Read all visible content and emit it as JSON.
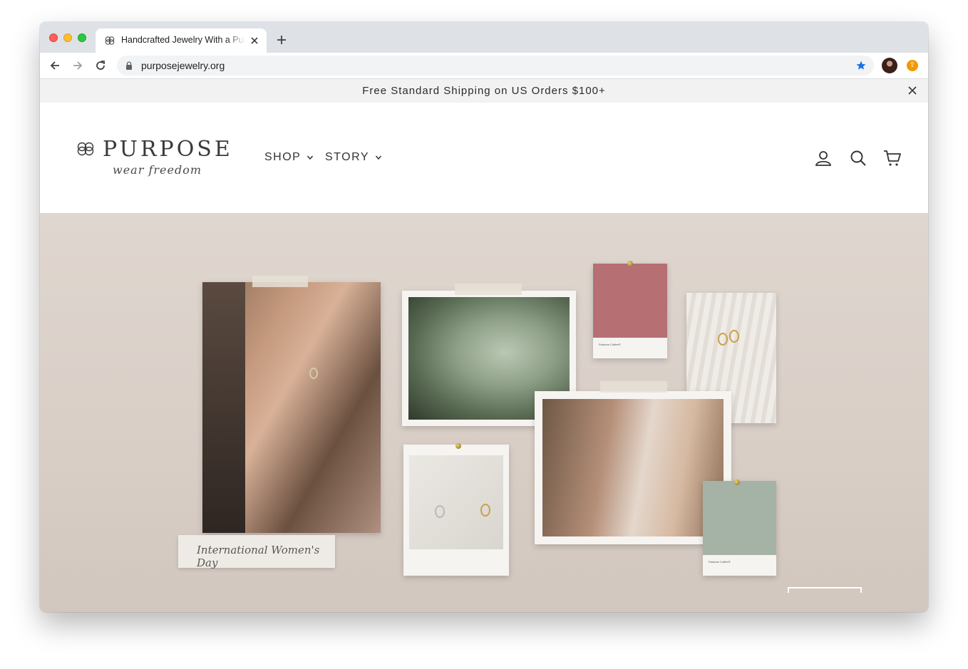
{
  "browser": {
    "tab_title": "Handcrafted Jewelry With a Purpose",
    "url": "purposejewelry.org"
  },
  "announcement": {
    "text": "Free Standard Shipping on US Orders $100+"
  },
  "site": {
    "logo_word": "PURPOSE",
    "logo_tagline": "wear freedom",
    "nav": [
      {
        "label": "SHOP"
      },
      {
        "label": "STORY"
      }
    ]
  },
  "hero": {
    "caption": "International Women's Day",
    "swatch_label_1": "Pantone Coffee®",
    "swatch_label_2": "Pantone Coffee®"
  },
  "colors": {
    "announce_bg": "#f2f2f2",
    "hero_bg": "#dfd6cf",
    "swatch_rose": "#b66f73",
    "swatch_sage": "#a5b3a6"
  }
}
